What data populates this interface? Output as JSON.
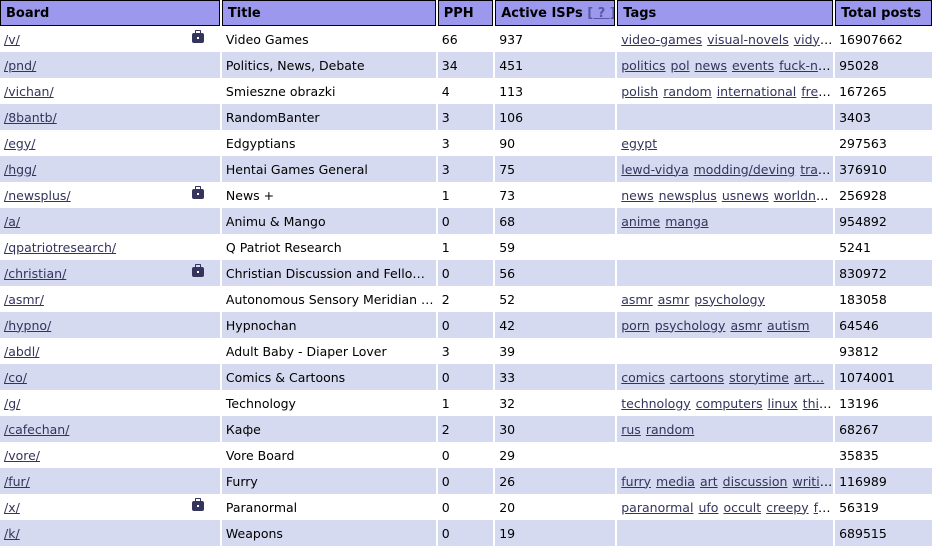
{
  "headers": {
    "board": "Board",
    "title": "Title",
    "pph": "PPH",
    "active_isps": "Active ISPs",
    "help": "[ ? ]",
    "tags": "Tags",
    "total_posts": "Total posts"
  },
  "rows": [
    {
      "board": "/v/",
      "badge": true,
      "title": "Video Games",
      "pph": "66",
      "isps": "937",
      "tags": [
        "video-games",
        "visual-novels",
        "vidy…"
      ],
      "total": "16907662"
    },
    {
      "board": "/pnd/",
      "badge": false,
      "title": "Politics, News, Debate",
      "pph": "34",
      "isps": "451",
      "tags": [
        "politics",
        "pol",
        "news",
        "events",
        "fuck-n…"
      ],
      "total": "95028"
    },
    {
      "board": "/vichan/",
      "badge": false,
      "title": "Smieszne obrazki",
      "pph": "4",
      "isps": "113",
      "tags": [
        "polish",
        "random",
        "international",
        "fre…"
      ],
      "total": "167265"
    },
    {
      "board": "/8bantb/",
      "badge": false,
      "title": "RandomBanter",
      "pph": "3",
      "isps": "106",
      "tags": [],
      "total": "3403"
    },
    {
      "board": "/egy/",
      "badge": false,
      "title": "Edgyptians",
      "pph": "3",
      "isps": "90",
      "tags": [
        "egypt"
      ],
      "total": "297563"
    },
    {
      "board": "/hgg/",
      "badge": false,
      "title": "Hentai Games General",
      "pph": "3",
      "isps": "75",
      "tags": [
        "lewd-vidya",
        "modding/deving",
        "tran…"
      ],
      "total": "376910"
    },
    {
      "board": "/newsplus/",
      "badge": true,
      "title": "News +",
      "pph": "1",
      "isps": "73",
      "tags": [
        "news",
        "newsplus",
        "usnews",
        "worldn…"
      ],
      "total": "256928"
    },
    {
      "board": "/a/",
      "badge": false,
      "title": "Animu & Mango",
      "pph": "0",
      "isps": "68",
      "tags": [
        "anime",
        "manga"
      ],
      "total": "954892"
    },
    {
      "board": "/qpatriotresearch/",
      "badge": false,
      "title": "Q Patriot Research",
      "pph": "1",
      "isps": "59",
      "tags": [],
      "total": "5241"
    },
    {
      "board": "/christian/",
      "badge": true,
      "title": "Christian Discussion and Fello…",
      "pph": "0",
      "isps": "56",
      "tags": [],
      "total": "830972"
    },
    {
      "board": "/asmr/",
      "badge": false,
      "title": "Autonomous Sensory Meridian …",
      "pph": "2",
      "isps": "52",
      "tags": [
        "asmr",
        "asmr",
        "psychology"
      ],
      "total": "183058"
    },
    {
      "board": "/hypno/",
      "badge": false,
      "title": "Hypnochan",
      "pph": "0",
      "isps": "42",
      "tags": [
        "porn",
        "psychology",
        "asmr",
        "autism"
      ],
      "total": "64546"
    },
    {
      "board": "/abdl/",
      "badge": false,
      "title": "Adult Baby - Diaper Lover",
      "pph": "3",
      "isps": "39",
      "tags": [],
      "total": "93812"
    },
    {
      "board": "/co/",
      "badge": false,
      "title": "Comics & Cartoons",
      "pph": "0",
      "isps": "33",
      "tags": [
        "comics",
        "cartoons",
        "storytime",
        "art…"
      ],
      "total": "1074001"
    },
    {
      "board": "/g/",
      "badge": false,
      "title": "Technology",
      "pph": "1",
      "isps": "32",
      "tags": [
        "technology",
        "computers",
        "linux",
        "thi…"
      ],
      "total": "13196"
    },
    {
      "board": "/cafechan/",
      "badge": false,
      "title": "Кафе",
      "pph": "2",
      "isps": "30",
      "tags": [
        "rus",
        "random"
      ],
      "total": "68267"
    },
    {
      "board": "/vore/",
      "badge": false,
      "title": "Vore Board",
      "pph": "0",
      "isps": "29",
      "tags": [],
      "total": "35835"
    },
    {
      "board": "/fur/",
      "badge": false,
      "title": "Furry",
      "pph": "0",
      "isps": "26",
      "tags": [
        "furry",
        "media",
        "art",
        "discussion",
        "writi…"
      ],
      "total": "116989"
    },
    {
      "board": "/x/",
      "badge": true,
      "title": "Paranormal",
      "pph": "0",
      "isps": "20",
      "tags": [
        "paranormal",
        "ufo",
        "occult",
        "creepy",
        "fr…"
      ],
      "total": "56319"
    },
    {
      "board": "/k/",
      "badge": false,
      "title": "Weapons",
      "pph": "0",
      "isps": "19",
      "tags": [],
      "total": "689515"
    }
  ]
}
